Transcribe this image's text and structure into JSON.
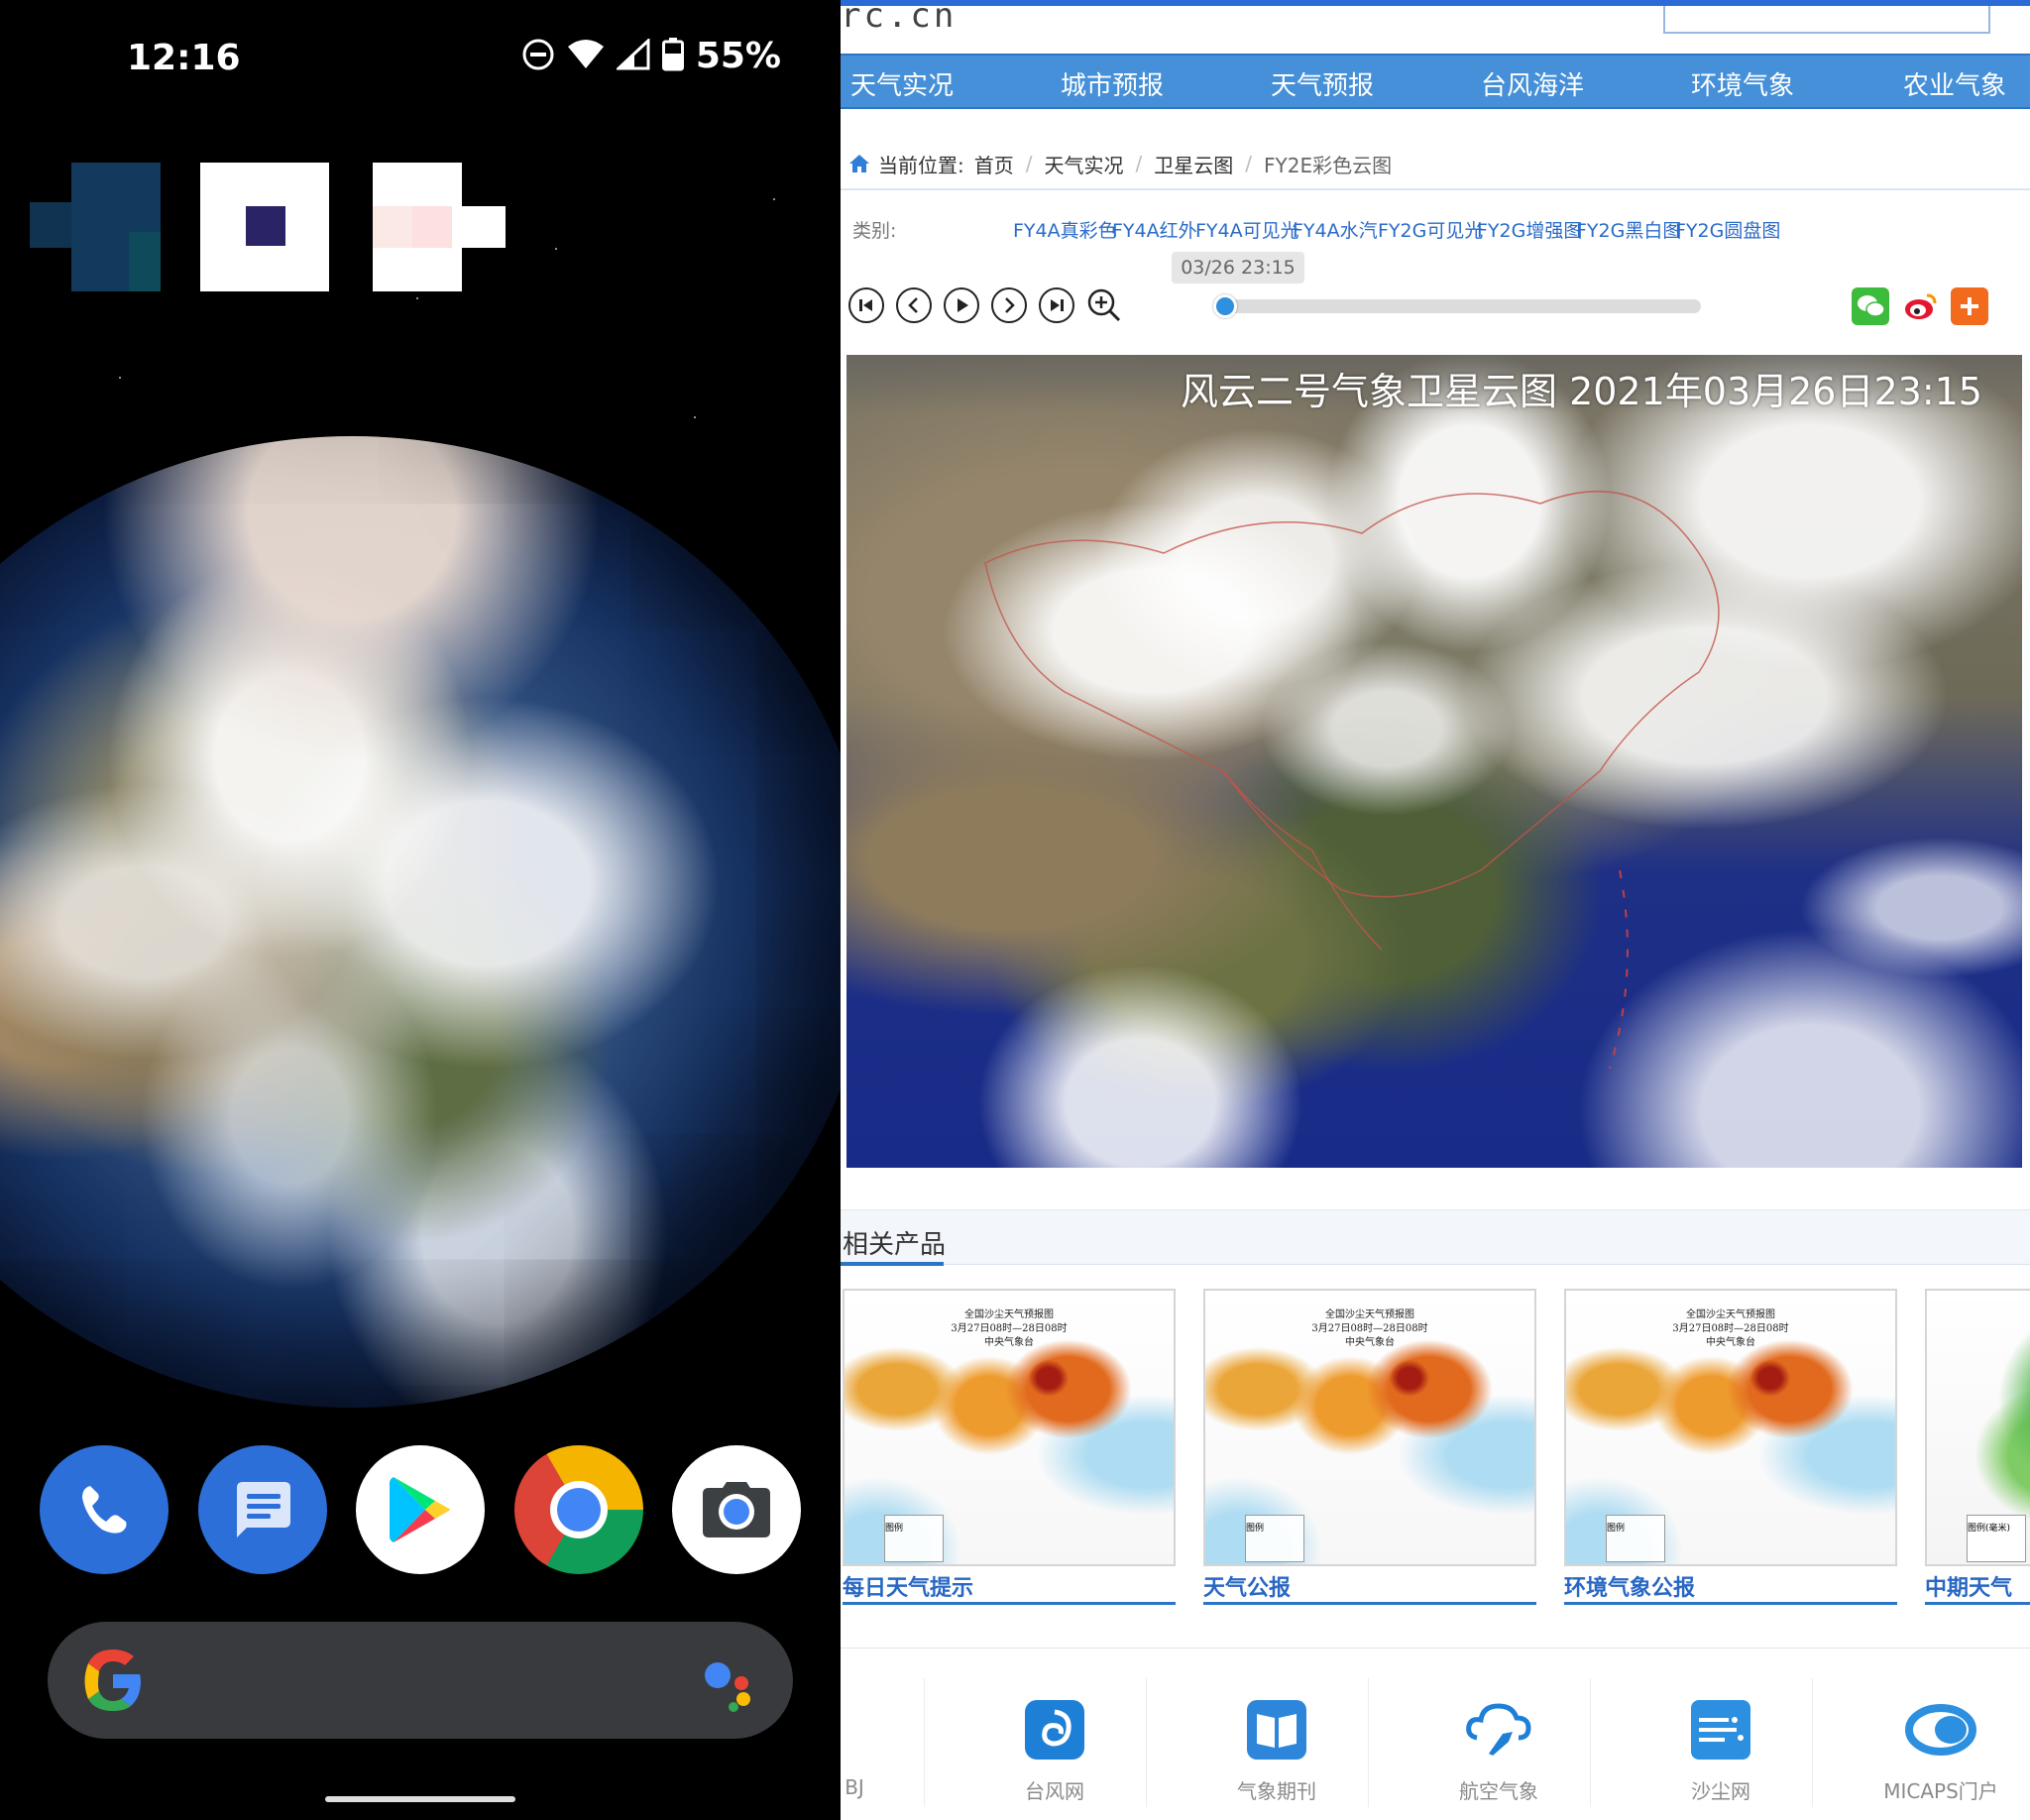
{
  "phone": {
    "status_bar": {
      "time": "12:16",
      "battery": "55%"
    },
    "dock_apps": [
      {
        "name": "Phone",
        "icon": "phone-icon"
      },
      {
        "name": "Messages",
        "icon": "messages-icon"
      },
      {
        "name": "Play Store",
        "icon": "play-store-icon"
      },
      {
        "name": "Chrome",
        "icon": "chrome-icon"
      },
      {
        "name": "Camera",
        "icon": "camera-icon"
      }
    ],
    "search_bar": {
      "left_icon": "google-g-icon",
      "right_icon": "assistant-icon"
    }
  },
  "web": {
    "url_fragment": "rc.cn",
    "nav": [
      "天气实况",
      "城市预报",
      "天气预报",
      "台风海洋",
      "环境气象",
      "农业气象"
    ],
    "breadcrumb": {
      "prefix": "当前位置:",
      "items": [
        "首页",
        "天气实况",
        "卫星云图"
      ],
      "current": "FY2E彩色云图"
    },
    "categories": {
      "label": "类别:",
      "items": [
        "FY4A真彩色",
        "FY4A红外",
        "FY4A可见光",
        "FY4A水汽",
        "FY2G可见光",
        "FY2G增强图",
        "FY2G黑白图",
        "FY2G圆盘图"
      ]
    },
    "player": {
      "time_badge": "03/26 23:15",
      "progress": 0,
      "controls": [
        "first-icon",
        "prev-icon",
        "play-icon",
        "next-icon",
        "last-icon",
        "zoom-in-icon"
      ],
      "share": [
        "wechat-icon",
        "weibo-icon",
        "add-icon"
      ]
    },
    "satellite": {
      "title": "风云二号气象卫星云图 2021年03月26日23:15"
    },
    "related": {
      "title": "相关产品",
      "products": [
        {
          "label": "每日天气提示",
          "map_title": [
            "全国沙尘天气预报图",
            "3月27日08时—28日08时",
            "中央气象台"
          ],
          "legend": "图例"
        },
        {
          "label": "天气公报",
          "map_title": [
            "全国沙尘天气预报图",
            "3月27日08时—28日08时",
            "中央气象台"
          ],
          "legend": "图例"
        },
        {
          "label": "环境气象公报",
          "map_title": [
            "全国沙尘天气预报图",
            "3月27日08时—28日08时",
            "中央气象台"
          ],
          "legend": "图例"
        },
        {
          "label": "中期天气",
          "map_title": [
            "",
            "",
            ""
          ],
          "legend": "图例(毫米)"
        }
      ]
    },
    "links": [
      {
        "label": "BJ",
        "icon": ""
      },
      {
        "label": "台风网",
        "icon": "typhoon-icon"
      },
      {
        "label": "气象期刊",
        "icon": "journal-icon"
      },
      {
        "label": "航空气象",
        "icon": "aviation-icon"
      },
      {
        "label": "沙尘网",
        "icon": "dust-icon"
      },
      {
        "label": "MICAPS门户",
        "icon": "micaps-icon"
      }
    ],
    "colors": {
      "nav_blue": "#4590d8",
      "link_blue": "#2a6bc8",
      "accent": "#2b74c6"
    }
  }
}
